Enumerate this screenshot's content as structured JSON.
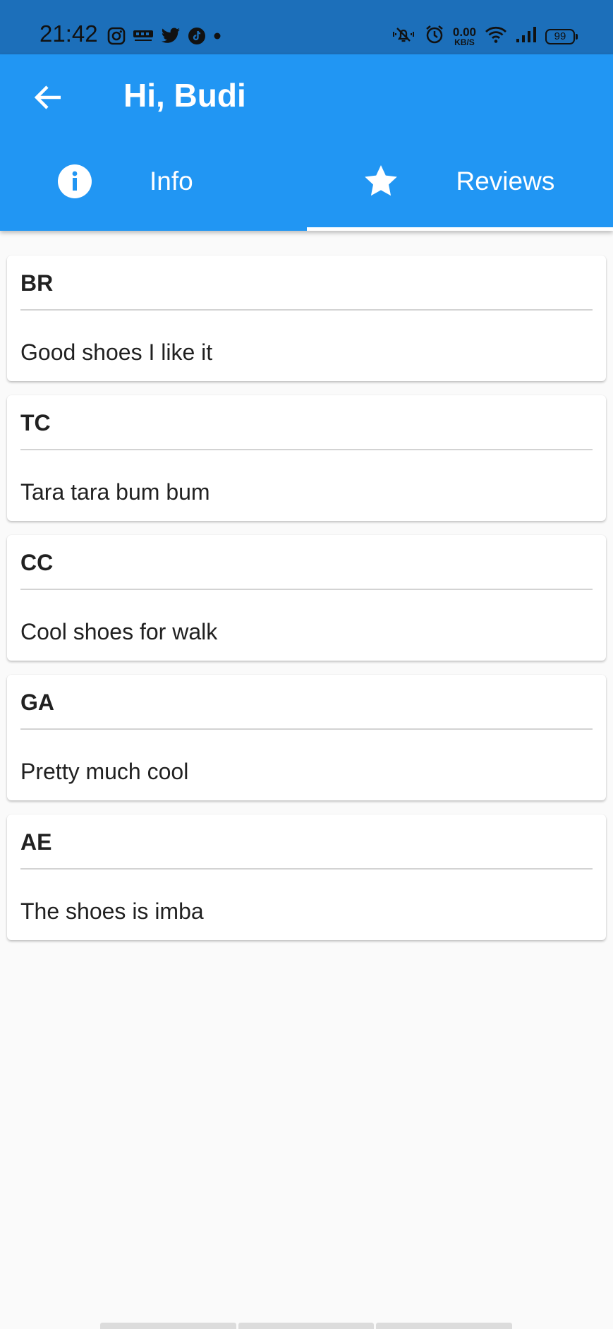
{
  "status_bar": {
    "time": "21:42",
    "left_icons": [
      "instagram-icon",
      "cnn-icon",
      "twitter-icon",
      "tiktok-icon",
      "notification-dot-icon"
    ],
    "network_speed_value": "0.00",
    "network_speed_unit": "KB/S",
    "battery_level": "99",
    "right_icons": [
      "mute-icon",
      "alarm-icon",
      "wifi-icon",
      "signal-icon",
      "battery-icon"
    ]
  },
  "app_bar": {
    "title": "Hi, Budi",
    "background_color": "#2196f3",
    "back_icon": "arrow-back-icon"
  },
  "tabs": [
    {
      "label": "Info",
      "icon": "info-icon",
      "selected": false
    },
    {
      "label": "Reviews",
      "icon": "star-icon",
      "selected": true
    }
  ],
  "reviews": [
    {
      "initials": "BR",
      "text": "Good shoes I like it"
    },
    {
      "initials": "TC",
      "text": "Tara tara bum bum"
    },
    {
      "initials": "CC",
      "text": "Cool shoes for walk"
    },
    {
      "initials": "GA",
      "text": "Pretty much cool"
    },
    {
      "initials": "AE",
      "text": "The shoes is imba"
    }
  ]
}
